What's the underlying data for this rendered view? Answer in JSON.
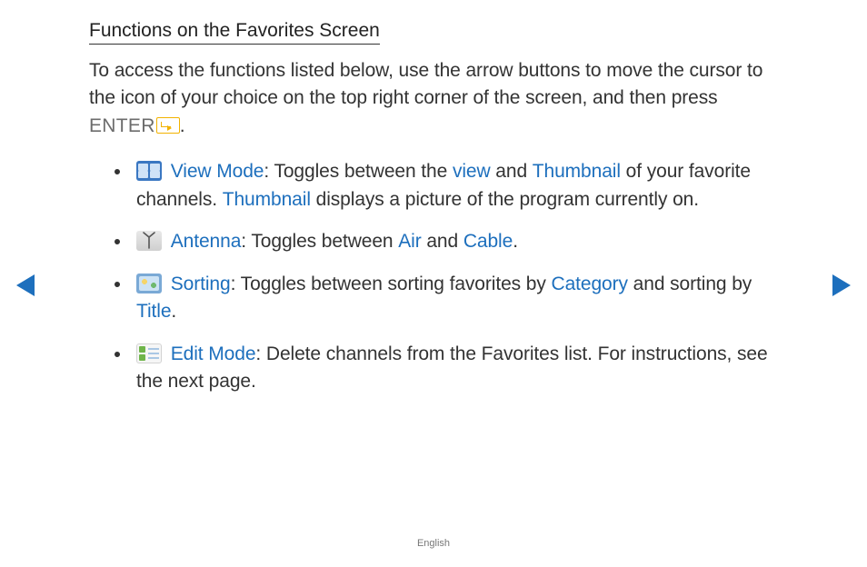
{
  "heading": "Functions on the Favorites Screen",
  "intro": {
    "text": "To access the functions listed below, use the arrow buttons to move the cursor to the icon of your choice on the top right corner of the screen, and then press ",
    "enter_label": "ENTER",
    "period": "."
  },
  "items": [
    {
      "icon": "view-mode-icon",
      "term": "View Mode",
      "seg1": ": Toggles between the ",
      "kw1": "view",
      "seg2": " and ",
      "kw2": "Thumbnail",
      "seg3": " of your favorite channels. ",
      "kw3": "Thumbnail",
      "seg4": " displays a picture of the program currently on."
    },
    {
      "icon": "antenna-icon",
      "term": "Antenna",
      "seg1": ": Toggles between ",
      "kw1": "Air",
      "seg2": " and ",
      "kw2": "Cable",
      "seg3": ".",
      "kw3": "",
      "seg4": ""
    },
    {
      "icon": "sorting-icon",
      "term": "Sorting",
      "seg1": ": Toggles between sorting favorites by ",
      "kw1": "Category",
      "seg2": " and sorting by ",
      "kw2": "Title",
      "seg3": ".",
      "kw3": "",
      "seg4": ""
    },
    {
      "icon": "edit-mode-icon",
      "term": "Edit Mode",
      "seg1": ": Delete channels from the Favorites list. For instructions, see the next page.",
      "kw1": "",
      "seg2": "",
      "kw2": "",
      "seg3": "",
      "kw3": "",
      "seg4": ""
    }
  ],
  "footer": "English"
}
